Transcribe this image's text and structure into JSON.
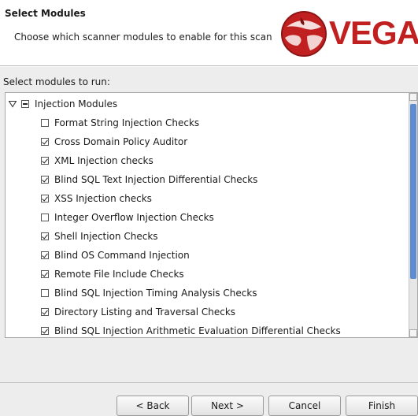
{
  "header": {
    "title": "Select Modules",
    "subtitle": "Choose which scanner modules to enable for this scan",
    "logo_text": "VEGA"
  },
  "modules_label": "Select modules to run:",
  "tree": {
    "root": {
      "label": "Injection Modules",
      "expanded": true,
      "state": "partial"
    },
    "items": [
      {
        "label": "Format String Injection Checks",
        "checked": false
      },
      {
        "label": "Cross Domain Policy Auditor",
        "checked": true
      },
      {
        "label": "XML Injection checks",
        "checked": true
      },
      {
        "label": "Blind SQL Text Injection Differential Checks",
        "checked": true
      },
      {
        "label": "XSS Injection checks",
        "checked": true
      },
      {
        "label": "Integer Overflow Injection Checks",
        "checked": false
      },
      {
        "label": "Shell Injection Checks",
        "checked": true
      },
      {
        "label": "Blind OS Command Injection",
        "checked": true
      },
      {
        "label": "Remote File Include Checks",
        "checked": true
      },
      {
        "label": "Blind SQL Injection Timing Analysis Checks",
        "checked": false
      },
      {
        "label": "Directory Listing and Traversal Checks",
        "checked": true
      },
      {
        "label": "Blind SQL Injection Arithmetic Evaluation Differential Checks",
        "checked": true
      }
    ]
  },
  "buttons": {
    "back": "< Back",
    "next": "Next >",
    "cancel": "Cancel",
    "finish": "Finish"
  },
  "colors": {
    "logo_red": "#c0201f",
    "scroll_thumb": "#5e8dd1"
  }
}
